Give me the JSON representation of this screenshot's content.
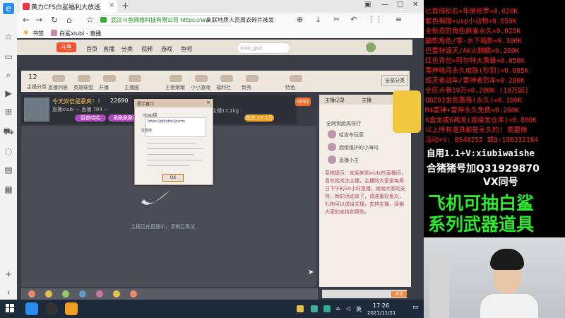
{
  "browser": {
    "tab_title": "黄力CFS白鲨福利大放送",
    "url": "武汉斗鱼网络科技有限公司 https://ww",
    "suggestion": "失联地质人员周衣碎片被发",
    "bookmarks": [
      "书签",
      "白鲨xiubi - 直播"
    ]
  },
  "site": {
    "nav": [
      "首页",
      "直播",
      "分类",
      "视频",
      "游戏",
      "鱼吧"
    ],
    "search_placeholder": "xiao_guo",
    "categories_count": "12",
    "categories_label": "主播分类",
    "categories": [
      "直播列表",
      "英雄联盟",
      "开播",
      "主播圈",
      "主播圈",
      "王者荣耀",
      "小小游戏",
      "福利社",
      "新秀",
      "特色"
    ],
    "category_button": "全部分类",
    "room_title": "今天双倍是震爽！！",
    "room_id": "22690",
    "room_sub": "直播xiubi ~ 直播 784 ~",
    "room_tag1": "狙是哈哈",
    "room_tag2": "刷刷刷刷",
    "room_right": "主播17.1kg",
    "room_follow": "关注 17.1万",
    "room_badge": "4F92",
    "player_message": "主播正在直播中，请稍后再试",
    "dialog": {
      "title": "提示窗口",
      "tag": "nbsp链",
      "url": "https://qfxxtbcfjcsmn",
      "label": "位置链"
    },
    "chat": {
      "tab1": "主播记录",
      "tab2": "主播",
      "rows": [
        "全网贡献周排行",
        "哈吉布玩家",
        "超级维护的小海马",
        "直播小主"
      ],
      "announcement": "系统提示：欢迎来到xiubi的直播间，喜欢就关注主播，主播的大家是每周日下午的24小时直播，谢谢大家的支持，新的活动来了，请准备好鱼丸，礼物可以送给主播，支持主播，感谢大家的支持和帮助。",
      "send": "发送"
    }
  },
  "taskbar": {
    "time": "17:26",
    "date": "2021/11/21",
    "ime": "英"
  },
  "overlay": {
    "lines": [
      "匕首绿松石+年册修罗=0.020K",
      "紫色捐赠+usp小动物=0.050K",
      "全新双防角色麻雀永久=0.025K",
      "鼬影角色/零-水下箱影=0.380K",
      "巴雷特毁灭/AK火麒麟=0.260K",
      "红色背包+阿尔特大黄蜂=0.050K",
      "雷神暗月永久皮肤(秒到)=0.085K",
      "毁灭者战车/雷神者烈车=0.280K",
      "全区点卷10万=0.280K (10万起)",
      "QBZ03金色蔷薇(永久)=0.180K",
      "M4雷神+雷神永久免费=0.280K",
      "6盒龙或6两龙(直接发仓库)=0.800K",
      "以上所有道具都是永久的! 需要微",
      "活动+V: BS48255  或Q:198332184"
    ],
    "self_use": "自用1.1+V:xiubiwaishe",
    "group": "合猪猪号加Q31929870",
    "vx": "VX同号",
    "big1": "飞机可抽白鲨",
    "big2": "系列武器道具"
  }
}
